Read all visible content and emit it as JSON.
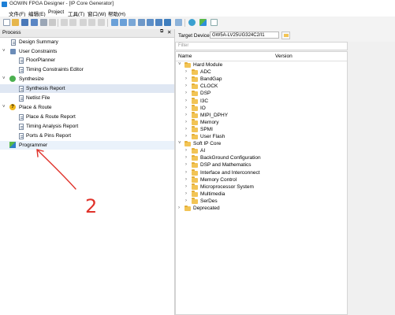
{
  "window": {
    "title": "GOWIN FPGA Designer - [IP Core Generator]"
  },
  "menu": [
    {
      "label": "文件(F)"
    },
    {
      "label": "编辑(E)"
    },
    {
      "label": "Project"
    },
    {
      "label": "工具(T)"
    },
    {
      "label": "窗口(W)"
    },
    {
      "label": "帮助(H)"
    }
  ],
  "process_panel": {
    "title": "Process",
    "items": [
      {
        "label": "Design Summary"
      },
      {
        "label": "User Constraints"
      },
      {
        "label": "FloorPlanner"
      },
      {
        "label": "Timing Constraints Editor"
      },
      {
        "label": "Synthesize"
      },
      {
        "label": "Synthesis Report"
      },
      {
        "label": "Netlist File"
      },
      {
        "label": "Place & Route"
      },
      {
        "label": "Place & Route Report"
      },
      {
        "label": "Timing Analysis Report"
      },
      {
        "label": "Ports & Pins Report"
      },
      {
        "label": "Programmer"
      }
    ]
  },
  "target_device": {
    "label": "Target Device:",
    "value": "GW5A-LV25UG324C2/I1"
  },
  "filter": {
    "placeholder": "Filter"
  },
  "ip_tree": {
    "columns": {
      "name": "Name",
      "version": "Version"
    },
    "groups": [
      {
        "label": "Hard Module",
        "children": [
          "ADC",
          "BandGap",
          "CLOCK",
          "DSP",
          "I3C",
          "IO",
          "MIPI_DPHY",
          "Memory",
          "SPMI",
          "User Flash"
        ]
      },
      {
        "label": "Soft IP Core",
        "children": [
          "AI",
          "BackGround Configuration",
          "DSP and Mathematics",
          "Interface and Interconnect",
          "Memory Control",
          "Microprocessor System",
          "Multimedia",
          "SerDes"
        ]
      },
      {
        "label": "Deprecated",
        "children": []
      }
    ]
  },
  "annotation": {
    "text": "2",
    "color": "#e0322a"
  }
}
